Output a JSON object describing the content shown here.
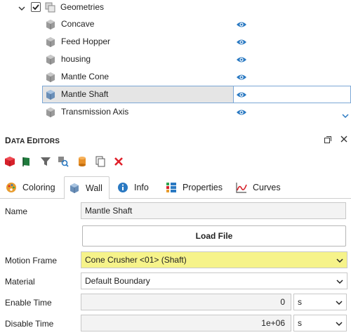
{
  "tree": {
    "root_label": "Geometries",
    "items": [
      {
        "label": "Concave"
      },
      {
        "label": "Feed Hopper"
      },
      {
        "label": "housing"
      },
      {
        "label": "Mantle Cone"
      },
      {
        "label": "Mantle Shaft"
      },
      {
        "label": "Transmission Axis"
      }
    ]
  },
  "panel": {
    "title_first": "D",
    "title_rest": "ATA ",
    "title_second_first": "E",
    "title_second_rest": "DITORS"
  },
  "toolbar": {
    "icons": [
      "red-cube-icon",
      "green-flag-icon",
      "filter-icon",
      "search-icon",
      "cylinder-icon",
      "copy-icon",
      "delete-icon"
    ]
  },
  "tabs": [
    {
      "label": "Coloring",
      "icon": "palette-icon"
    },
    {
      "label": "Wall",
      "icon": "geometry-icon"
    },
    {
      "label": "Info",
      "icon": "info-icon"
    },
    {
      "label": "Properties",
      "icon": "properties-icon"
    },
    {
      "label": "Curves",
      "icon": "curves-icon"
    }
  ],
  "form": {
    "name_label": "Name",
    "name_value": "Mantle Shaft",
    "load_file_label": "Load File",
    "motion_frame_label": "Motion Frame",
    "motion_frame_value": "Cone Crusher <01> (Shaft)",
    "material_label": "Material",
    "material_value": "Default Boundary",
    "enable_time_label": "Enable Time",
    "enable_time_value": "0",
    "enable_time_unit": "s",
    "disable_time_label": "Disable Time",
    "disable_time_value": "1e+06",
    "disable_time_unit": "s"
  },
  "colors": {
    "accent": "#2a79c2",
    "highlight": "#f6f38a",
    "selection": "#e5e5e5"
  }
}
